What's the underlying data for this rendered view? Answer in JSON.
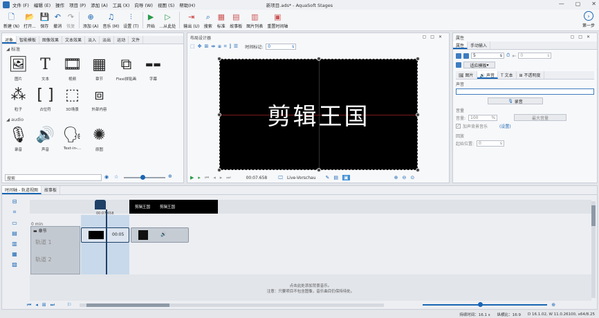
{
  "window": {
    "title": "新项目.ads* - AquaSoft Stages",
    "controls": [
      "—",
      "▢",
      "✕"
    ]
  },
  "menu": [
    "文件 (F)",
    "编辑 (E)",
    "操作",
    "项目 (P)",
    "添加 (A)",
    "工具 (X)",
    "向导 (W)",
    "视图 (S)",
    "帮助(H)"
  ],
  "toolbar": [
    {
      "label": "新建 (N)",
      "icon": "new-icon"
    },
    {
      "label": "打开...",
      "icon": "open-icon"
    },
    {
      "label": "保存",
      "icon": "save-icon"
    },
    {
      "label": "撤消",
      "icon": "undo-icon"
    },
    {
      "label": "恢复",
      "icon": "redo-icon"
    },
    {
      "label": "添加 (A)",
      "icon": "add-icon"
    },
    {
      "label": "音乐 (M)",
      "icon": "music-icon"
    },
    {
      "label": "设置 (T)",
      "icon": "settings-icon"
    },
    {
      "label": "开始",
      "icon": "play-icon"
    },
    {
      "label": "...从此处",
      "icon": "play-from-here-icon"
    },
    {
      "label": "输出 (U)",
      "icon": "export-icon"
    },
    {
      "label": "搜索",
      "icon": "search-icon"
    },
    {
      "label": "标准",
      "icon": "standard-icon"
    },
    {
      "label": "故事板",
      "icon": "storyboard-icon"
    },
    {
      "label": "图片列表",
      "icon": "image-list-icon"
    },
    {
      "label": "重置时间轴",
      "icon": "reset-timeline-icon"
    }
  ],
  "next_step": "第一步",
  "left_panel": {
    "tabs": [
      "对象",
      "智能模板",
      "图像效果",
      "文本效果",
      "淡入",
      "淡出",
      "运动",
      "文件"
    ],
    "active_tab": "对象",
    "section_standard": "标准",
    "section_audio": "audio",
    "objects": [
      {
        "label": "图片",
        "icon": "image-icon"
      },
      {
        "label": "文本",
        "icon": "text-icon"
      },
      {
        "label": "视频",
        "icon": "video-icon"
      },
      {
        "label": "章节",
        "icon": "chapter-icon"
      },
      {
        "label": "Flexi拼贴画",
        "icon": "flexi-collage-icon"
      },
      {
        "label": "字幕",
        "icon": "subtitle-icon"
      },
      {
        "label": "粒子",
        "icon": "particles-icon"
      },
      {
        "label": "占位符",
        "icon": "placeholder-icon"
      },
      {
        "label": "3D场景",
        "icon": "3d-scene-icon"
      },
      {
        "label": "外部内容",
        "icon": "external-content-icon"
      }
    ],
    "audio_objects": [
      {
        "label": "录音",
        "icon": "recording-icon"
      },
      {
        "label": "声音",
        "icon": "sound-icon"
      },
      {
        "label": "Text-in-...",
        "icon": "text-to-speech-icon"
      },
      {
        "label": "原图",
        "icon": "original-image-icon"
      }
    ],
    "search_placeholder": "搜索"
  },
  "center_panel": {
    "title": "布局设计器",
    "time_marker_label": "时间标记:",
    "time_marker_value": "0",
    "time_unit": "s",
    "stage_text": "剪辑王国",
    "playback_time": "00:07.658",
    "preview_mode": "Live-Vorschau"
  },
  "right_panel": {
    "title": "属性",
    "tabs": [
      "属性",
      "手动输入"
    ],
    "value_field": "5",
    "value_field_unit": "s",
    "duration_field": "0",
    "duration_unit": "s",
    "fit_mode": "适应模板",
    "subtabs": [
      "图片",
      "声音",
      "文本",
      "不透明度"
    ],
    "active_subtab": "声音",
    "sound_label": "声音",
    "record_button": "录音",
    "volume_section": "音量",
    "volume_label": "音量:",
    "volume_value": "100",
    "volume_unit": "%",
    "max_volume_button": "最大音量",
    "background_music_checkbox": "加声背景音乐",
    "background_music_link": "(设置)",
    "rewind_section": "回放",
    "start_position_label": "起始位置:",
    "start_position_value": "0",
    "start_position_unit": "s"
  },
  "timeline": {
    "tabs": [
      "时间轴 - 轨道视图",
      "故事板"
    ],
    "active_tab": "时间轴 - 轨道视图",
    "time_zero": "0 min",
    "playhead_time": "00:07.658",
    "chapter_label": "章节",
    "track1": "轨道 1",
    "track2": "轨道 2",
    "clip_duration": "00:05",
    "thumb_texts": [
      "剪辑王国",
      "剪辑王国"
    ],
    "add_music_hint": "点击此处添加背景音乐。",
    "add_music_note": "注意：只要项目不包含图像，音乐曲目仍保持待处。"
  },
  "statusbar": {
    "duration": "持续时间：16.1 s",
    "aspect": "纵横比：16:9",
    "version": "D 16.1.02, W 11.0.26100, x64/8.25"
  }
}
